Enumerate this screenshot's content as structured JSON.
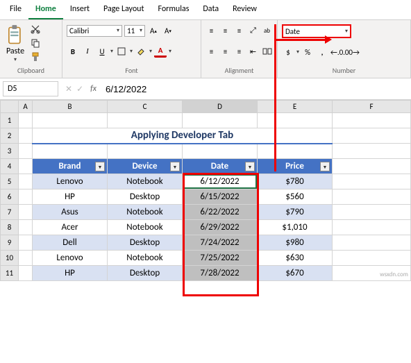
{
  "menu": {
    "file": "File",
    "home": "Home",
    "insert": "Insert",
    "pagelayout": "Page Layout",
    "formulas": "Formulas",
    "data": "Data",
    "review": "Review"
  },
  "clipboard": {
    "paste": "Paste",
    "group": "Clipboard"
  },
  "font": {
    "name": "Calibri",
    "size": "11",
    "b": "B",
    "i": "I",
    "u": "U",
    "group": "Font"
  },
  "alignment": {
    "wrap": "ab",
    "group": "Alignment"
  },
  "number": {
    "format": "Date",
    "currency": "$",
    "percent": "%",
    "comma": ",",
    "incdec": ".0",
    "decdec": ".00",
    "group": "Number"
  },
  "fbar": {
    "name": "D5",
    "fx": "fx",
    "val": "6/12/2022"
  },
  "cols": [
    "A",
    "B",
    "C",
    "D",
    "E",
    "F"
  ],
  "rows": [
    "1",
    "2",
    "3",
    "4",
    "5",
    "6",
    "7",
    "8",
    "9",
    "10",
    "11"
  ],
  "title": "Applying Developer Tab",
  "headers": {
    "brand": "Brand",
    "device": "Device",
    "date": "Date",
    "price": "Price"
  },
  "data": [
    {
      "brand": "Lenovo",
      "device": "Notebook",
      "date": "6/12/2022",
      "price": "$780"
    },
    {
      "brand": "HP",
      "device": "Desktop",
      "date": "6/15/2022",
      "price": "$560"
    },
    {
      "brand": "Asus",
      "device": "Notebook",
      "date": "6/22/2022",
      "price": "$790"
    },
    {
      "brand": "Acer",
      "device": "Notebook",
      "date": "6/29/2022",
      "price": "$1,010"
    },
    {
      "brand": "Dell",
      "device": "Desktop",
      "date": "7/24/2022",
      "price": "$980"
    },
    {
      "brand": "Lenovo",
      "device": "Notebook",
      "date": "7/25/2022",
      "price": "$630"
    },
    {
      "brand": "HP",
      "device": "Desktop",
      "date": "7/28/2022",
      "price": "$670"
    }
  ],
  "watermark": "wsxdn.com",
  "chart_data": {
    "type": "table",
    "title": "Applying Developer Tab",
    "columns": [
      "Brand",
      "Device",
      "Date",
      "Price"
    ],
    "rows": [
      [
        "Lenovo",
        "Notebook",
        "6/12/2022",
        780
      ],
      [
        "HP",
        "Desktop",
        "6/15/2022",
        560
      ],
      [
        "Asus",
        "Notebook",
        "6/22/2022",
        790
      ],
      [
        "Acer",
        "Notebook",
        "6/29/2022",
        1010
      ],
      [
        "Dell",
        "Desktop",
        "7/24/2022",
        980
      ],
      [
        "Lenovo",
        "Notebook",
        "7/25/2022",
        630
      ],
      [
        "HP",
        "Desktop",
        "7/28/2022",
        670
      ]
    ]
  }
}
